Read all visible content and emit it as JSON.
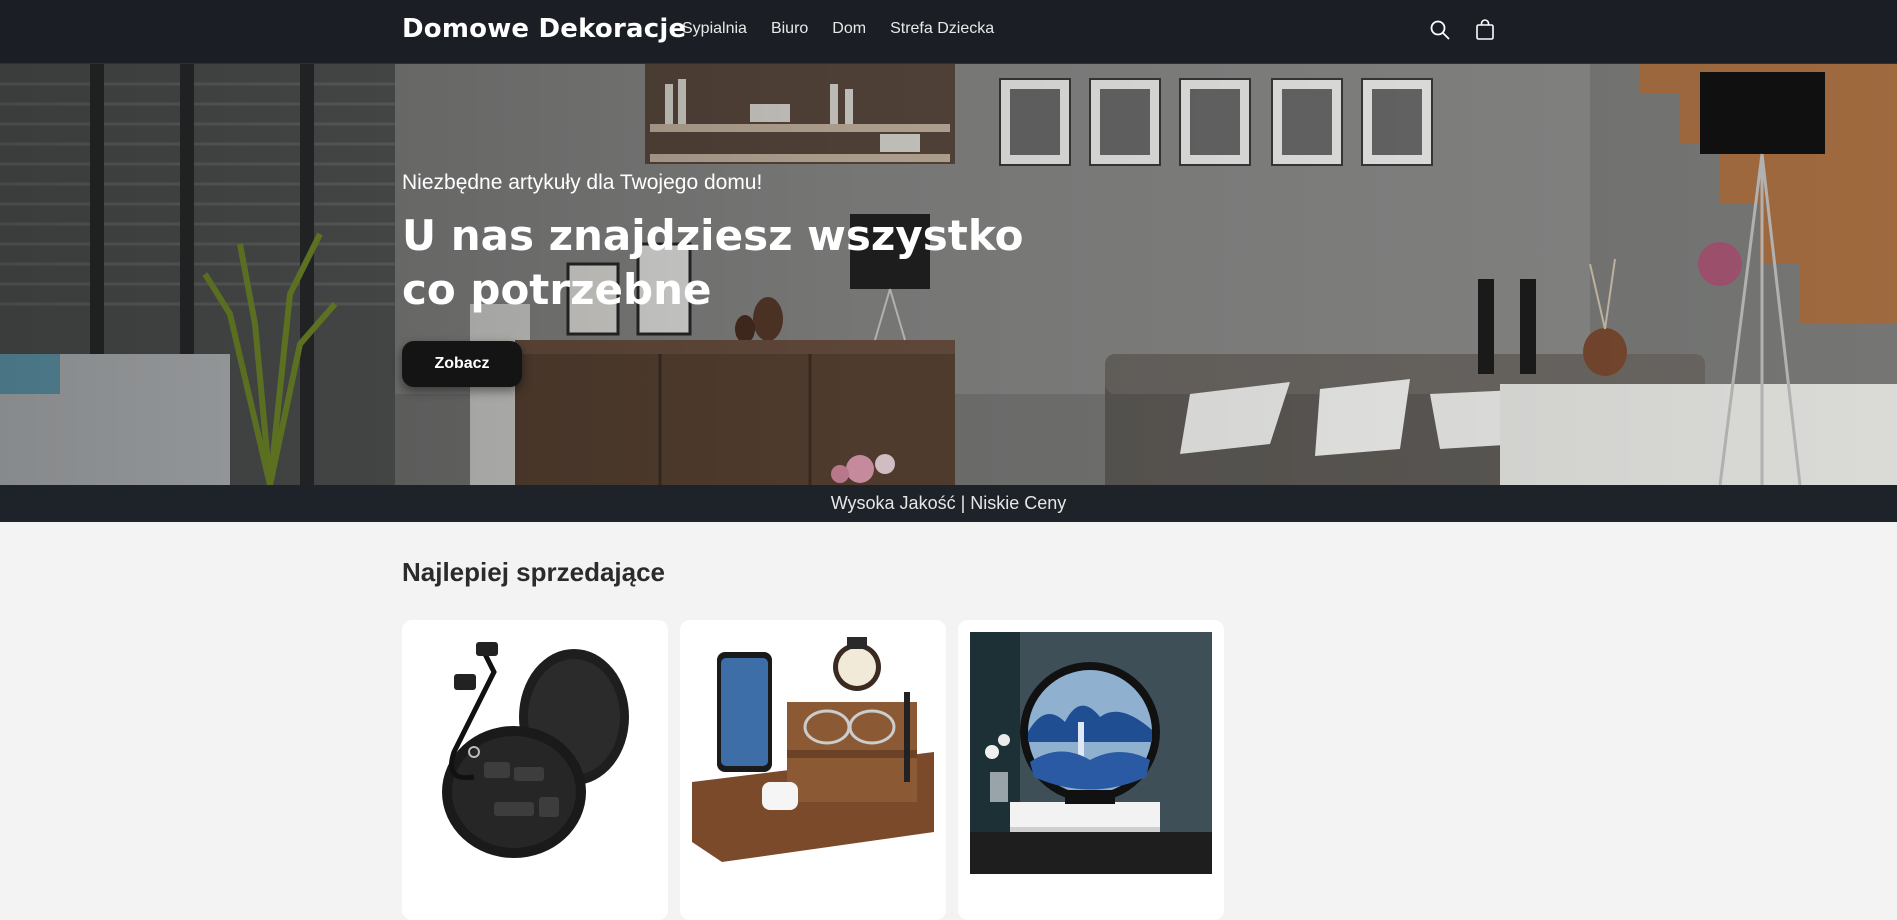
{
  "header": {
    "logo": "Domowe Dekoracje",
    "nav": [
      {
        "label": "Sypialnia"
      },
      {
        "label": "Biuro"
      },
      {
        "label": "Dom"
      },
      {
        "label": "Strefa Dziecka"
      }
    ],
    "icons": [
      "search-icon",
      "cart-icon"
    ]
  },
  "hero": {
    "eyebrow": "Niezbędne artykuły dla Twojego domu!",
    "title": "U nas znajdziesz wszystko co potrzebne",
    "button_label": "Zobacz"
  },
  "announcement": {
    "text": "Wysoka Jakość | Niskie Ceny"
  },
  "products": {
    "section_title": "Najlepiej sprzedające",
    "items": [
      {
        "image": "cable-organizer-case"
      },
      {
        "image": "wooden-docking-station"
      },
      {
        "image": "sand-art-frame"
      }
    ]
  },
  "colors": {
    "header_bg": "#1b1f25",
    "announcement_bg": "#1e2329",
    "page_bg": "#f3f3f3",
    "button_bg": "#141414"
  }
}
